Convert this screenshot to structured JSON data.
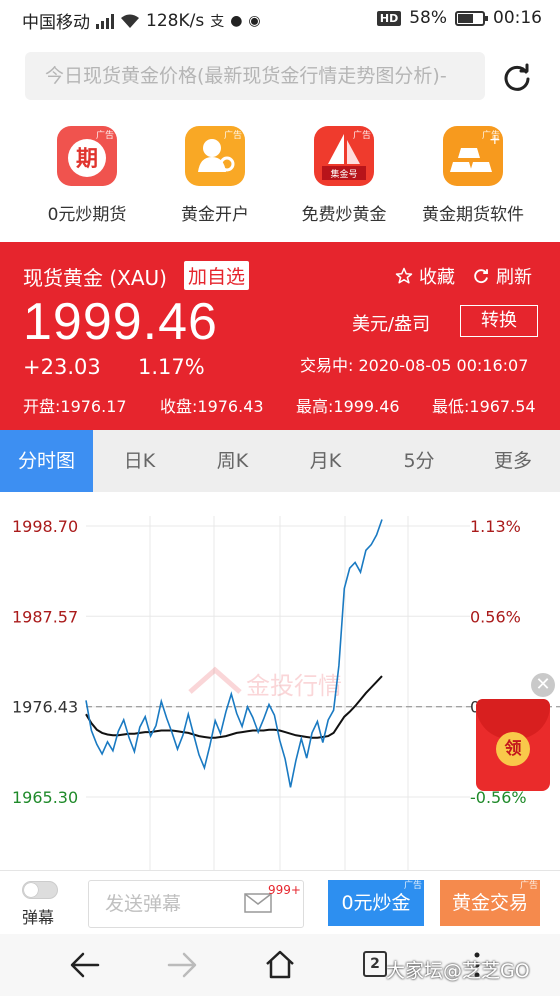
{
  "status_bar": {
    "carrier": "中国移动",
    "network": "4G",
    "speed": "128K/s",
    "hd": "HD",
    "battery": "58%",
    "time": "00:16"
  },
  "search": {
    "text": "今日现货黄金价格(最新现货金行情走势图分析)-"
  },
  "ads": [
    {
      "label": "0元炒期货",
      "icon": "qi-futures-icon",
      "glyph": "期",
      "tag": "广告",
      "color": "#f0534e"
    },
    {
      "label": "黄金开户",
      "icon": "account-person-icon",
      "glyph": "",
      "tag": "广告",
      "color": "#f9a825"
    },
    {
      "label": "免费炒黄金",
      "icon": "sailboat-icon",
      "glyph": "集金号",
      "tag": "广告",
      "color": "#ef3b2d"
    },
    {
      "label": "黄金期货软件",
      "icon": "gold-bars-icon",
      "glyph": "",
      "tag": "广告",
      "color": "#f79a1e"
    }
  ],
  "quote": {
    "title": "现货黄金 (XAU)",
    "add_watch": "加自选",
    "favorite": "收藏",
    "refresh": "刷新",
    "price": "1999.46",
    "unit": "美元/盎司",
    "convert": "转换",
    "change": "+23.03",
    "change_pct": "1.17%",
    "status": "交易中: 2020-08-05 00:16:07",
    "open": "开盘:1976.17",
    "prev_close": "收盘:1976.43",
    "high": "最高:1999.46",
    "low": "最低:1967.54"
  },
  "tabs": [
    "分时图",
    "日K",
    "周K",
    "月K",
    "5分",
    "更多"
  ],
  "chart_data": {
    "type": "line",
    "y_left_ticks": [
      "1998.70",
      "1987.57",
      "1976.43",
      "1965.30"
    ],
    "y_right_ticks": [
      "1.13%",
      "0.56%",
      "0.00%",
      "-0.56%"
    ],
    "ylim": [
      1959.8,
      2004.2
    ],
    "baseline": 1976.43,
    "watermark": "金投行情",
    "colors": {
      "up": "#aa1b1b",
      "down": "#1f8a2a",
      "price": "#1a7ac2",
      "avg": "#111111"
    },
    "series": [
      {
        "values": [
          1977.2,
          1973.5,
          1971.8,
          1970.6,
          1972.1,
          1971.0,
          1973.4,
          1974.8,
          1972.6,
          1970.9,
          1973.9,
          1975.2,
          1972.8,
          1974.1,
          1977.1,
          1975.0,
          1973.2,
          1971.2,
          1972.9,
          1975.5,
          1973.0,
          1970.5,
          1968.9,
          1971.6,
          1974.7,
          1973.1,
          1975.8,
          1978.0,
          1975.6,
          1974.0,
          1976.4,
          1975.1,
          1973.3,
          1974.9,
          1976.7,
          1975.4,
          1972.3,
          1970.0,
          1966.5,
          1969.8,
          1972.5,
          1970.1,
          1973.2,
          1974.6,
          1972.0,
          1974.8,
          1976.0,
          1981.5,
          1991.0,
          1993.5,
          1994.2,
          1993.0,
          1995.7,
          1996.4,
          1997.6,
          1999.5
        ]
      },
      {
        "values": [
          1975.5,
          1974.4,
          1973.6,
          1973.2,
          1973.0,
          1972.9,
          1972.9,
          1973.0,
          1973.1,
          1973.1,
          1973.2,
          1973.3,
          1973.3,
          1973.4,
          1973.5,
          1973.5,
          1973.5,
          1973.4,
          1973.3,
          1973.2,
          1973.0,
          1972.8,
          1972.7,
          1972.6,
          1972.6,
          1972.7,
          1972.8,
          1973.0,
          1973.2,
          1973.3,
          1973.4,
          1973.5,
          1973.5,
          1973.5,
          1973.6,
          1973.6,
          1973.5,
          1973.3,
          1973.1,
          1972.9,
          1972.8,
          1972.7,
          1972.6,
          1972.6,
          1972.7,
          1972.8,
          1973.2,
          1974.2,
          1975.2,
          1975.8,
          1976.5,
          1977.3,
          1978.1,
          1978.8,
          1979.5,
          1980.2
        ]
      }
    ]
  },
  "envelope": {
    "label": "领",
    "close": "✕"
  },
  "bottom": {
    "toggle_label": "弹幕",
    "danmu_placeholder": "发送弹幕",
    "danmu_count": "999+",
    "btn_free": "0元炒金",
    "btn_trade": "黄金交易",
    "ad_tag": "广告"
  },
  "nav": {
    "tab_count": "2",
    "watermark": "大家坛@芝芝GO"
  }
}
